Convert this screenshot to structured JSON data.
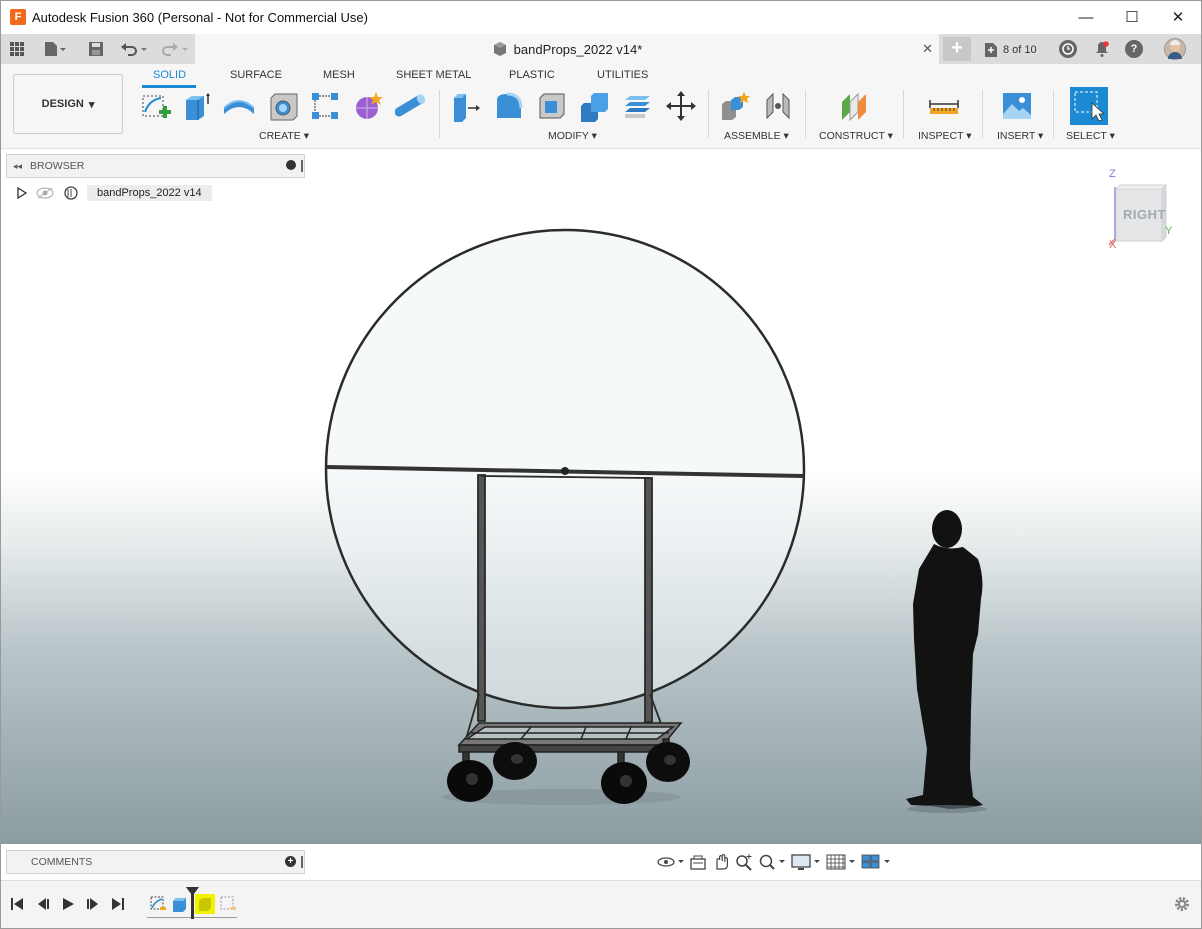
{
  "window": {
    "title": "Autodesk Fusion 360 (Personal - Not for Commercial Use)",
    "logo_letter": "F",
    "controls": {
      "minimize": "—",
      "maximize": "☐",
      "close": "✕"
    }
  },
  "tabbar": {
    "document_title": "bandProps_2022 v14*",
    "close": "✕",
    "new_tab": "+",
    "version_count": "8 of 10",
    "user_initial": "",
    "notifications_icon": "bell-icon",
    "help": "?"
  },
  "toolbar": {
    "workspace": "DESIGN",
    "tabs": [
      "SOLID",
      "SURFACE",
      "MESH",
      "SHEET METAL",
      "PLASTIC",
      "UTILITIES"
    ],
    "active_tab": "SOLID",
    "groups": {
      "create": "CREATE",
      "modify": "MODIFY",
      "assemble": "ASSEMBLE",
      "construct": "CONSTRUCT",
      "inspect": "INSPECT",
      "insert": "INSERT",
      "select": "SELECT"
    },
    "dropdown_marker": "▾"
  },
  "browser": {
    "header": "BROWSER",
    "collapse": "◂◂",
    "item_label": "bandProps_2022 v14"
  },
  "viewcube": {
    "face": "RIGHT",
    "axis_z": "Z",
    "axis_y": "Y",
    "axis_x": "X"
  },
  "comments": {
    "label": "COMMENTS",
    "add": "+"
  },
  "colors": {
    "accent": "#1c8ad2",
    "logo": "#f26b1d",
    "timeline_highlight": "#f2f200"
  }
}
